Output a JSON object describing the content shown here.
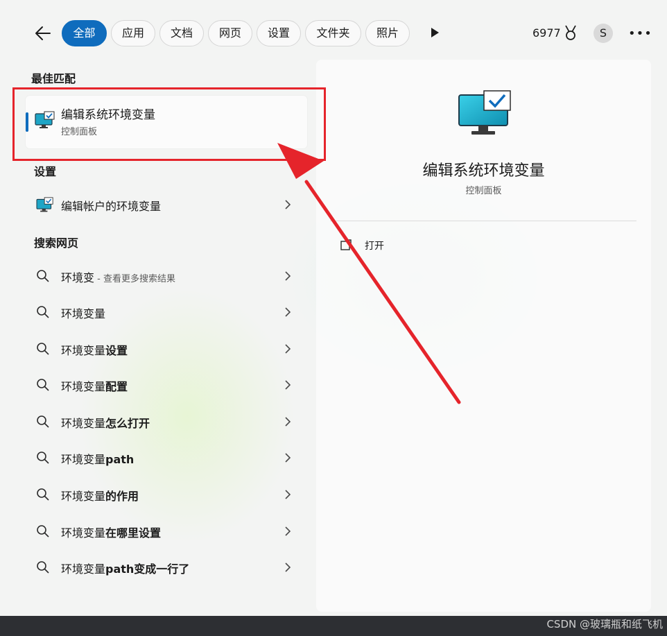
{
  "tabs": [
    {
      "label": "全部",
      "active": true
    },
    {
      "label": "应用"
    },
    {
      "label": "文档"
    },
    {
      "label": "网页"
    },
    {
      "label": "设置"
    },
    {
      "label": "文件夹"
    },
    {
      "label": "照片"
    }
  ],
  "header": {
    "points": "6977",
    "avatar_initial": "S"
  },
  "best_match": {
    "section": "最佳匹配",
    "title": "编辑系统环境变量",
    "subtitle": "控制面板"
  },
  "settings": {
    "section": "设置",
    "item": "编辑帐户的环境变量"
  },
  "web": {
    "section": "搜索网页",
    "first": {
      "query": "环境变",
      "hint": " - 查看更多搜索结果"
    },
    "items": [
      {
        "base": "环境变量",
        "rest": ""
      },
      {
        "base": "环境变量",
        "rest": "设置"
      },
      {
        "base": "环境变量",
        "rest": "配置"
      },
      {
        "base": "环境变量",
        "rest": "怎么打开"
      },
      {
        "base": "环境变量",
        "rest": "path"
      },
      {
        "base": "环境变量",
        "rest": "的作用"
      },
      {
        "base": "环境变量",
        "rest": "在哪里设置"
      },
      {
        "base": "环境变量",
        "rest": "path变成一行了"
      }
    ]
  },
  "detail": {
    "title": "编辑系统环境变量",
    "subtitle": "控制面板",
    "open_label": "打开"
  },
  "watermark": "CSDN @玻璃瓶和纸飞机",
  "colors": {
    "accent": "#0f6cbd",
    "annotation": "#e5242b"
  }
}
